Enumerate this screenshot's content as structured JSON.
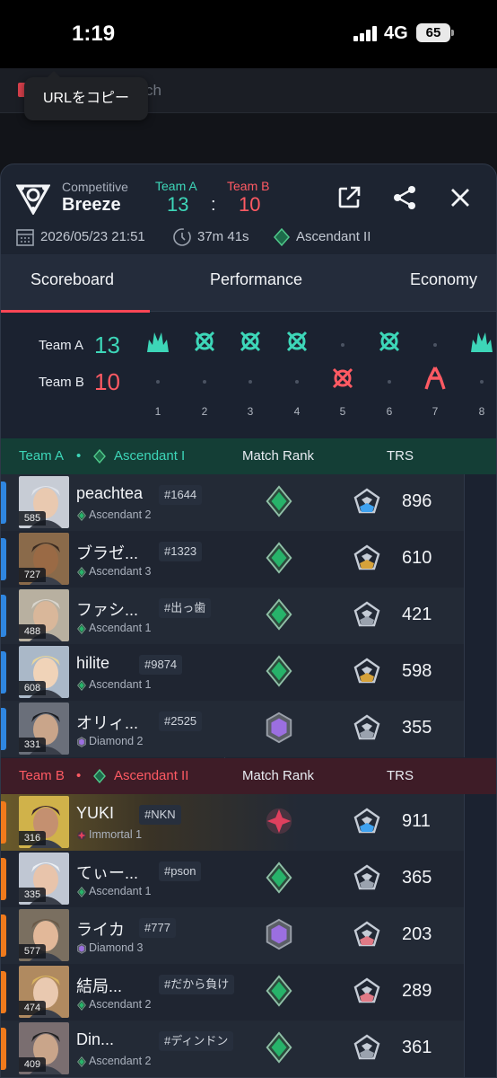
{
  "status": {
    "time": "1:19",
    "network": "4G",
    "battery": "65"
  },
  "background": {
    "search_placeholder": "ch",
    "tooltip": "URLをコピー"
  },
  "match": {
    "mode": "Competitive",
    "map": "Breeze",
    "team_a_label": "Team A",
    "team_b_label": "Team B",
    "score_a": "13",
    "separator": ":",
    "score_b": "10",
    "date": "2026/05/23 21:51",
    "duration": "37m 41s",
    "avg_rank": "Ascendant II"
  },
  "tabs": [
    "Scoreboard",
    "Performance",
    "Economy"
  ],
  "timeline": {
    "team_a_name": "Team A",
    "team_a_score": "13",
    "team_b_name": "Team B",
    "team_b_score": "10",
    "rounds": [
      "1",
      "2",
      "3",
      "4",
      "5",
      "6",
      "7",
      "8"
    ],
    "round_results": [
      {
        "winner": "A",
        "icon": "spike-detonate-icon"
      },
      {
        "winner": "A",
        "icon": "elimination-icon"
      },
      {
        "winner": "A",
        "icon": "elimination-icon"
      },
      {
        "winner": "A",
        "icon": "elimination-icon"
      },
      {
        "winner": "B",
        "icon": "elimination-icon"
      },
      {
        "winner": "A",
        "icon": "elimination-icon"
      },
      {
        "winner": "B",
        "icon": "defuse-icon"
      },
      {
        "winner": "A",
        "icon": "spike-detonate-icon"
      }
    ]
  },
  "team_a": {
    "name": "Team A",
    "bullet": "•",
    "avg_rank": "Ascendant I",
    "col_match_rank": "Match Rank",
    "col_trs": "TRS",
    "players": [
      {
        "name": "peachtea",
        "tag": "#1644",
        "level": "585",
        "rank": "Ascendant 2",
        "rank_tier": "ascendant",
        "match_rank": "ascendant",
        "trs": "896",
        "trs_tier": "blue"
      },
      {
        "name": "ブラゼ...",
        "tag": "#1323",
        "level": "727",
        "rank": "Ascendant 3",
        "rank_tier": "ascendant",
        "match_rank": "ascendant",
        "trs": "610",
        "trs_tier": "gold"
      },
      {
        "name": "ファシ...",
        "tag": "#出っ歯",
        "level": "488",
        "rank": "Ascendant 1",
        "rank_tier": "ascendant",
        "match_rank": "ascendant",
        "trs": "421",
        "trs_tier": "silver"
      },
      {
        "name": "hilite",
        "tag": "#9874",
        "level": "608",
        "rank": "Ascendant 1",
        "rank_tier": "ascendant",
        "match_rank": "ascendant",
        "trs": "598",
        "trs_tier": "gold"
      },
      {
        "name": "オリィ...",
        "tag": "#2525",
        "level": "331",
        "rank": "Diamond 2",
        "rank_tier": "diamond",
        "match_rank": "diamond",
        "trs": "355",
        "trs_tier": "silver"
      }
    ]
  },
  "team_b": {
    "name": "Team B",
    "bullet": "•",
    "avg_rank": "Ascendant II",
    "col_match_rank": "Match Rank",
    "col_trs": "TRS",
    "players": [
      {
        "name": "YUKI",
        "tag": "#NKN",
        "level": "316",
        "rank": "Immortal 1",
        "rank_tier": "immortal",
        "match_rank": "immortal",
        "trs": "911",
        "trs_tier": "blue"
      },
      {
        "name": "てぃー...",
        "tag": "#pson",
        "level": "335",
        "rank": "Ascendant 1",
        "rank_tier": "ascendant",
        "match_rank": "ascendant",
        "trs": "365",
        "trs_tier": "silver"
      },
      {
        "name": "ライカ",
        "tag": "#777",
        "level": "577",
        "rank": "Diamond 3",
        "rank_tier": "diamond",
        "match_rank": "diamond",
        "trs": "203",
        "trs_tier": "red"
      },
      {
        "name": "結局...",
        "tag": "#だから負け",
        "level": "474",
        "rank": "Ascendant 2",
        "rank_tier": "ascendant",
        "match_rank": "ascendant",
        "trs": "289",
        "trs_tier": "red"
      },
      {
        "name": "Din...",
        "tag": "#ディンドン",
        "level": "409",
        "rank": "Ascendant 2",
        "rank_tier": "ascendant",
        "match_rank": "ascendant",
        "trs": "361",
        "trs_tier": "silver"
      }
    ]
  },
  "colors": {
    "team_a": "#3dd6b8",
    "team_b": "#ff5a63",
    "accent": "#ff4655",
    "sheet_bg": "#1d2431",
    "team_a_header": "#143e36",
    "team_b_header": "#3e1c27"
  }
}
